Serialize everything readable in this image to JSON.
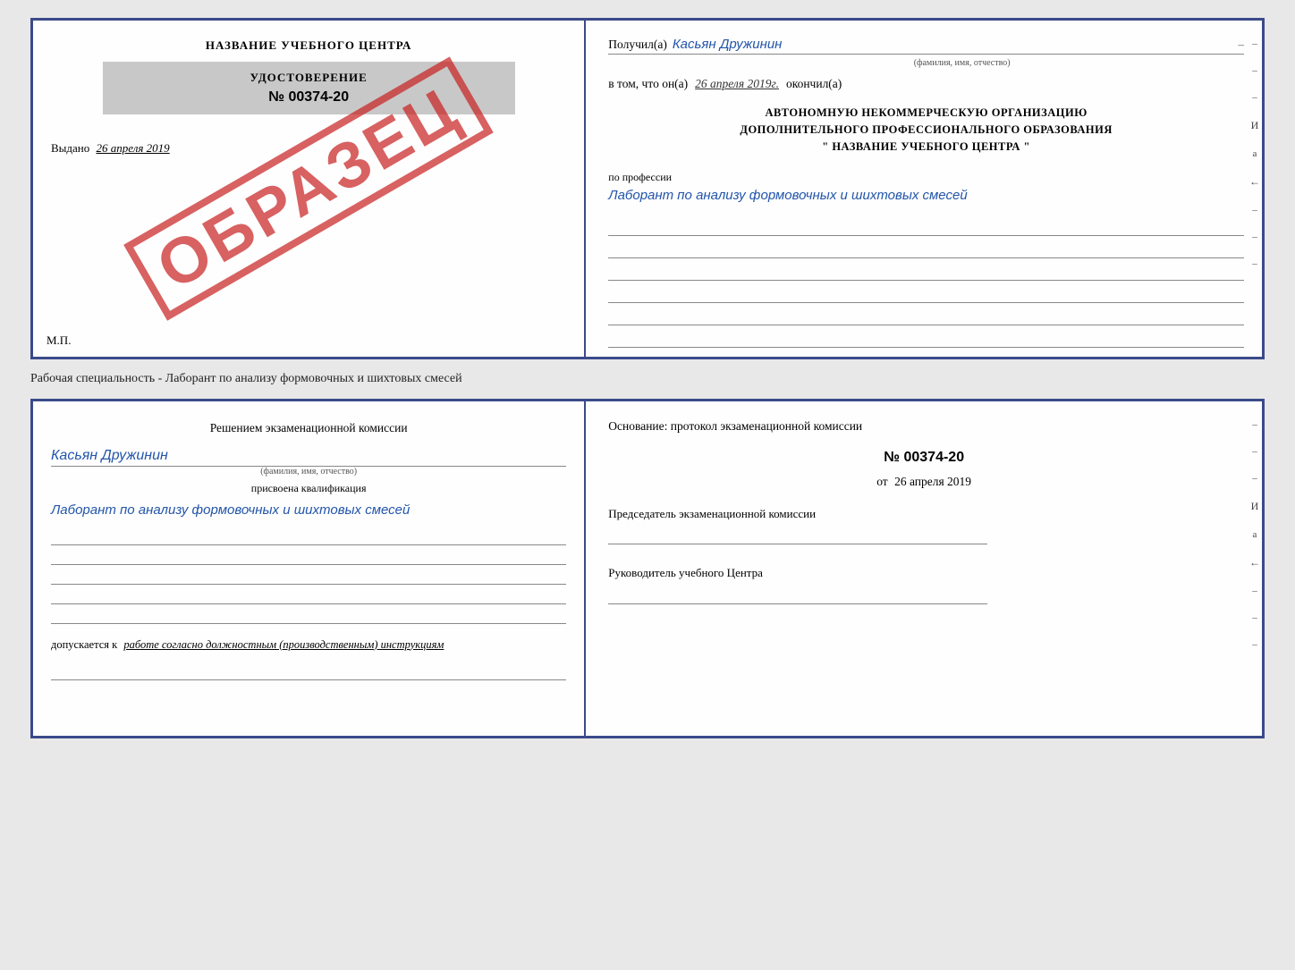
{
  "top_doc": {
    "left": {
      "title": "НАЗВАНИЕ УЧЕБНОГО ЦЕНТРА",
      "cert_label": "УДОСТОВЕРЕНИЕ",
      "cert_number": "№ 00374-20",
      "vydano_label": "Выдано",
      "vydano_date": "26 апреля 2019",
      "mp": "М.П.",
      "stamp": "ОБРАЗЕЦ"
    },
    "right": {
      "recipient_prefix": "Получил(а)",
      "recipient_name": "Касьян Дружинин",
      "recipient_sub": "(фамилия, имя, отчество)",
      "date_prefix": "в том, что он(а)",
      "date_value": "26 апреля 2019г.",
      "okoncil": "окончил(а)",
      "org_line1": "АВТОНОМНУЮ НЕКОММЕРЧЕСКУЮ ОРГАНИЗАЦИЮ",
      "org_line2": "ДОПОЛНИТЕЛЬНОГО ПРОФЕССИОНАЛЬНОГО ОБРАЗОВАНИЯ",
      "org_line3": "\"  НАЗВАНИЕ УЧЕБНОГО ЦЕНТРА  \"",
      "profession_label": "по профессии",
      "profession_value": "Лаборант по анализу формовочных и шихтовых смесей"
    }
  },
  "separator": {
    "text": "Рабочая специальность - Лаборант по анализу формовочных и шихтовых смесей"
  },
  "bottom_doc": {
    "left": {
      "komissia_text": "Решением  экзаменационной  комиссии",
      "name_value": "Касьян Дружинин",
      "name_sub": "(фамилия, имя, отчество)",
      "kvalif_label": "присвоена квалификация",
      "kvalif_value": "Лаборант по анализу формовочных и шихтовых смесей",
      "dopuskaetsya_prefix": "допускается к",
      "dopuskaetsya_value": "работе согласно должностным (производственным) инструкциям"
    },
    "right": {
      "osnov_text": "Основание: протокол экзаменационной комиссии",
      "protocol_number": "№  00374-20",
      "date_prefix": "от",
      "date_value": "26 апреля 2019",
      "predsed_label": "Председатель экзаменационной комиссии",
      "rukovod_label": "Руководитель учебного Центра",
      "side_marks": [
        "–",
        "–",
        "–",
        "И",
        "а",
        "←",
        "–",
        "–",
        "–"
      ]
    }
  }
}
